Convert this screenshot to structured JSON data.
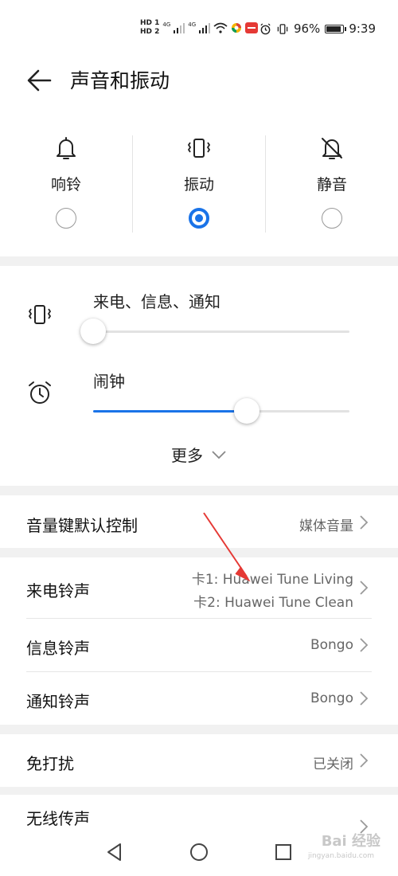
{
  "status_bar": {
    "sim1": "HD 1",
    "sim2": "HD 2",
    "net1": "4G",
    "net2": "4G",
    "battery_pct": "96%",
    "battery_level": 0.96,
    "time": "9:39"
  },
  "header": {
    "title": "声音和振动"
  },
  "modes": {
    "items": [
      {
        "label": "响铃",
        "icon": "bell-icon",
        "selected": false
      },
      {
        "label": "振动",
        "icon": "vibrate-icon",
        "selected": true
      },
      {
        "label": "静音",
        "icon": "bell-off-icon",
        "selected": false
      }
    ]
  },
  "volume": {
    "ring": {
      "label": "来电、信息、通知",
      "icon": "vibrate-icon",
      "level": 0.0
    },
    "alarm": {
      "label": "闹钟",
      "icon": "alarm-clock-icon",
      "level": 0.6
    },
    "more_label": "更多"
  },
  "settings": {
    "volume_key": {
      "title": "音量键默认控制",
      "value": "媒体音量"
    },
    "ringtone": {
      "title": "来电铃声",
      "value1": "卡1: Huawei Tune Living",
      "value2": "卡2: Huawei Tune Clean"
    },
    "message_tone": {
      "title": "信息铃声",
      "value": "Bongo"
    },
    "notification_tone": {
      "title": "通知铃声",
      "value": "Bongo"
    },
    "dnd": {
      "title": "免打扰",
      "value": "已关闭"
    },
    "wireless": {
      "title": "无线传声"
    }
  },
  "watermark": {
    "brand": "Bai 经验",
    "url": "jingyan.baidu.com"
  },
  "colors": {
    "accent": "#1a73e8",
    "annotation": "#e53935",
    "divider_band": "#f1f1f1"
  }
}
